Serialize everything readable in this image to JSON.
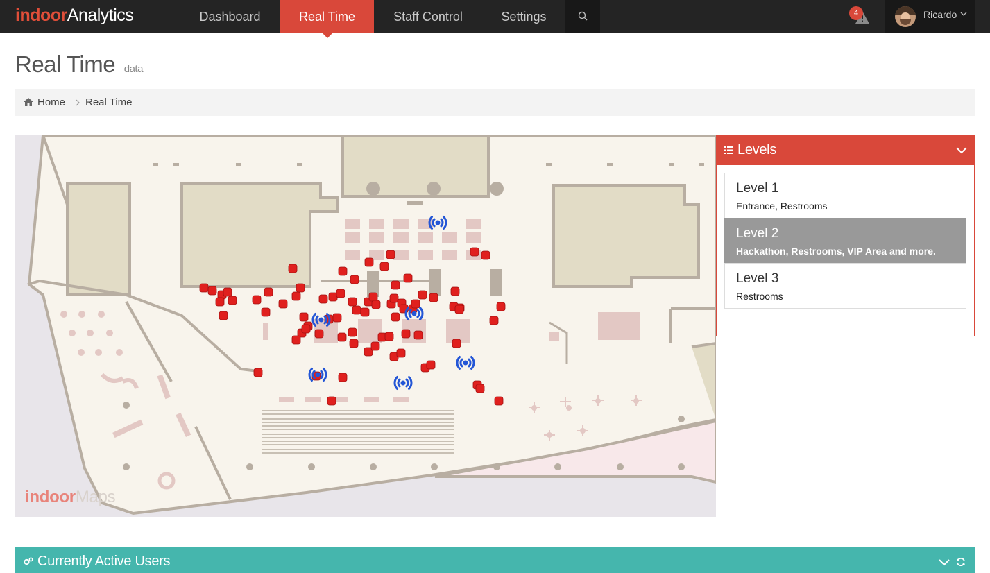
{
  "brand": {
    "part1": "indoor",
    "part2": "Analytics"
  },
  "nav": {
    "items": [
      {
        "label": "Dashboard",
        "active": false
      },
      {
        "label": "Real Time",
        "active": true
      },
      {
        "label": "Staff Control",
        "active": false
      },
      {
        "label": "Settings",
        "active": false
      }
    ],
    "search_icon": "search-icon",
    "alerts_count": "4",
    "user_name": "Ricardo"
  },
  "page": {
    "title": "Real Time",
    "subtitle": "data"
  },
  "breadcrumb": {
    "home": "Home",
    "current": "Real Time"
  },
  "map": {
    "logo_part1": "indoor",
    "logo_part2": "Maps",
    "visitor_color": "#e0201e",
    "beacon_color": "#2456d6"
  },
  "levels": {
    "title": "Levels",
    "items": [
      {
        "name": "Level 1",
        "desc": "Entrance, Restrooms",
        "active": false
      },
      {
        "name": "Level 2",
        "desc": "Hackathon, Restrooms, VIP Area and more.",
        "active": true
      },
      {
        "name": "Level 3",
        "desc": "Restrooms",
        "active": false
      }
    ]
  },
  "active_users": {
    "title": "Currently Active Users"
  },
  "colors": {
    "accent": "#d9483a",
    "teal": "#45b6ad",
    "navbar": "#242424"
  }
}
